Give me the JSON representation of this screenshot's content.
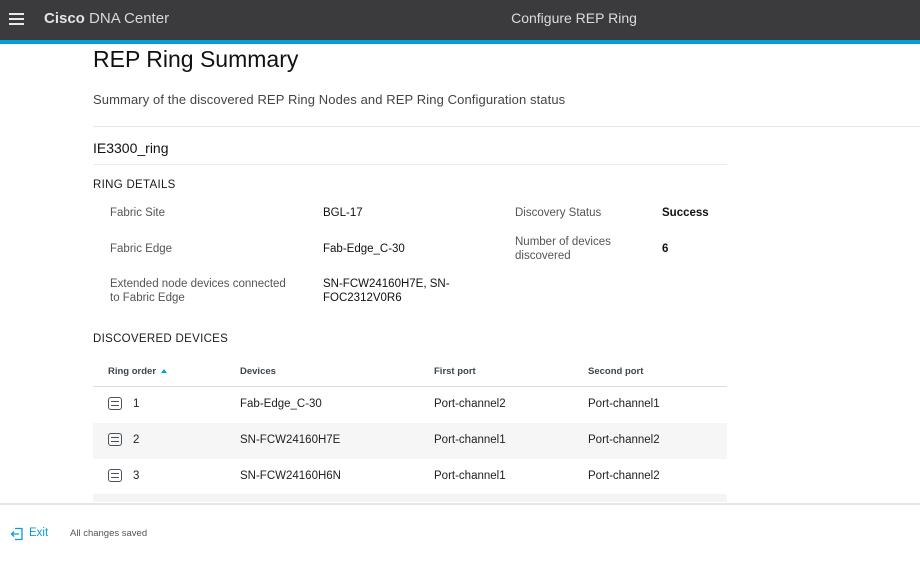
{
  "header": {
    "brand_bold": "Cisco",
    "brand_rest": " DNA Center",
    "page_title": "Configure REP Ring"
  },
  "page": {
    "title": "REP Ring Summary",
    "subtitle": "Summary of the discovered REP Ring Nodes and REP Ring Configuration status",
    "ring_name": "IE3300_ring"
  },
  "ring_details": {
    "section_title": "RING DETAILS",
    "fabric_site_label": "Fabric Site",
    "fabric_site_value": "BGL-17",
    "fabric_edge_label": "Fabric Edge",
    "fabric_edge_value": "Fab-Edge_C-30",
    "extended_label_line1": "Extended node devices connected",
    "extended_label_line2": "to Fabric Edge",
    "extended_value_line1": "SN-FCW24160H7E, SN-",
    "extended_value_line2": "FOC2312V0R6",
    "discovery_status_label": "Discovery Status",
    "discovery_status_value": "Success",
    "num_devices_label_line1": "Number of devices",
    "num_devices_label_line2": "discovered",
    "num_devices_value": "6"
  },
  "discovered_devices": {
    "section_title": "DISCOVERED DEVICES",
    "columns": [
      "Ring order",
      "Devices",
      "First port",
      "Second port"
    ],
    "rows": [
      {
        "order": "1",
        "device": "Fab-Edge_C-30",
        "first_port": "Port-channel2",
        "second_port": "Port-channel1"
      },
      {
        "order": "2",
        "device": "SN-FCW24160H7E",
        "first_port": "Port-channel1",
        "second_port": "Port-channel2"
      },
      {
        "order": "3",
        "device": "SN-FCW24160H6N",
        "first_port": "Port-channel1",
        "second_port": "Port-channel2"
      }
    ]
  },
  "footer": {
    "exit_label": "Exit",
    "status_text": "All changes saved"
  },
  "colors": {
    "topbar": "#3b3b3e",
    "accent": "#049fd9"
  },
  "icons": {
    "menu": "hamburger-icon",
    "device": "switch-icon",
    "exit": "exit-icon"
  }
}
